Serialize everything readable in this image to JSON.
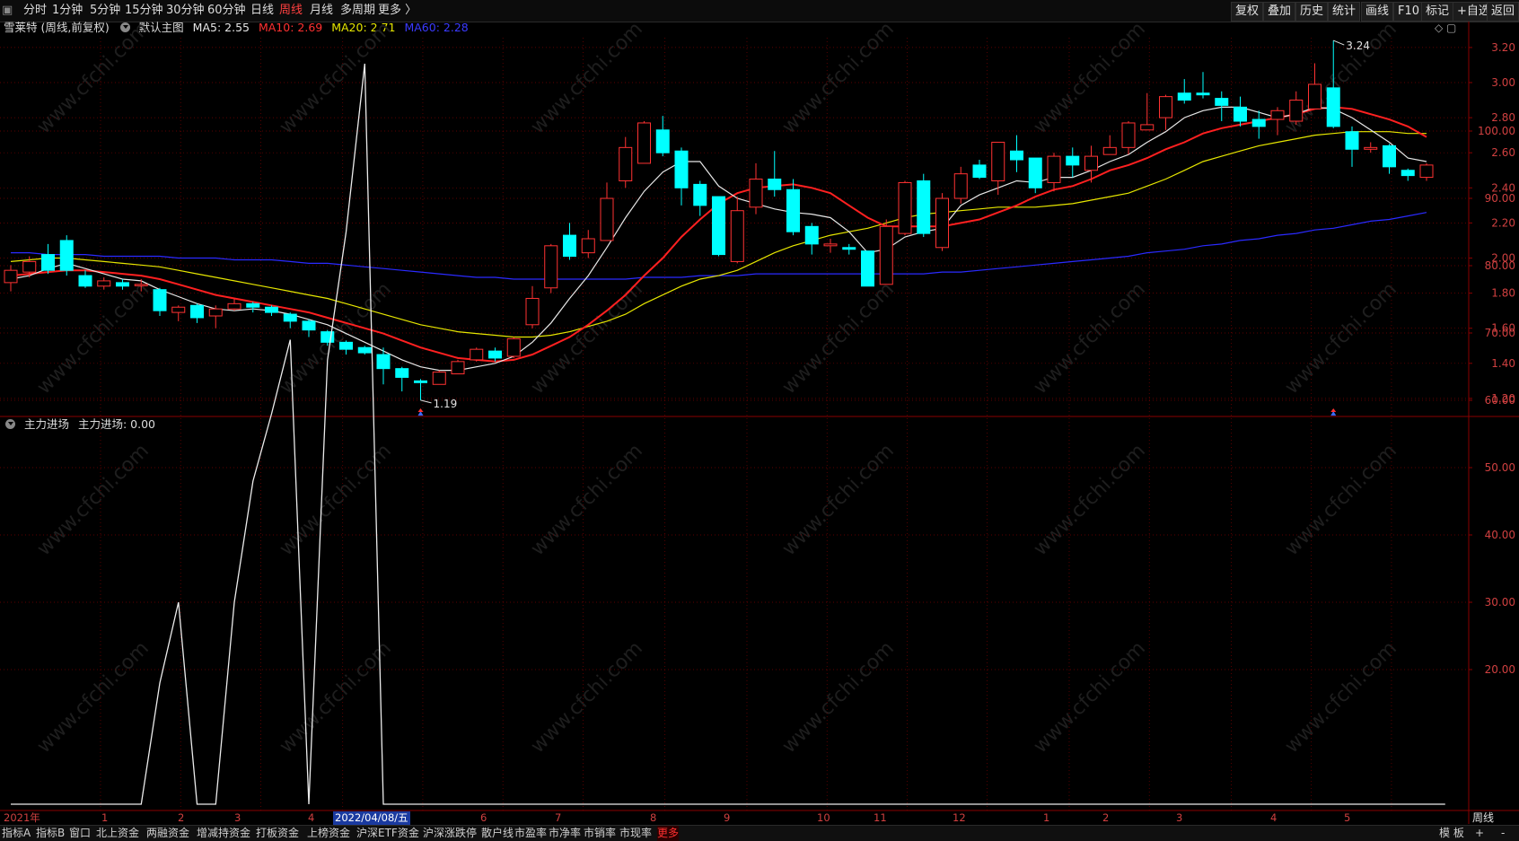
{
  "toolbar": {
    "left_items": [
      "分时",
      "1分钟",
      "5分钟",
      "15分钟",
      "30分钟",
      "60分钟",
      "日线",
      "周线",
      "月线",
      "多周期",
      "更多 〉"
    ],
    "active": "周线",
    "right_items": [
      "复权",
      "叠加",
      "历史",
      "统计",
      "画线",
      "F10",
      "标记",
      "+自选",
      "返回"
    ]
  },
  "main_legend": {
    "title": "雪莱特 (周线,前复权)",
    "template": "默认主图",
    "ma5": "MA5: 2.55",
    "ma10": "MA10: 2.69",
    "ma20": "MA20: 2.71",
    "ma60": "MA60: 2.28"
  },
  "sub_legend": {
    "title": "主力进场",
    "value": "主力进场: 0.00"
  },
  "colors": {
    "up": "#ff3232",
    "down": "#00ffff",
    "ma5": "#e6e6e6",
    "ma10": "#ff2020",
    "ma20": "#e6e600",
    "ma60": "#2a2aff",
    "grid": "#7a0000"
  },
  "price_axis": [
    "3.20",
    "3.00",
    "2.80",
    "2.60",
    "2.40",
    "2.20",
    "2.00",
    "1.80",
    "1.60",
    "1.40",
    "1.20"
  ],
  "indicator_axis": [
    "100.00",
    "90.00",
    "80.00",
    "70.00",
    "60.00",
    "50.00",
    "40.00",
    "30.00",
    "20.00"
  ],
  "annotations": {
    "high": "3.24",
    "low": "1.19"
  },
  "date_labels": [
    "2021年",
    "1",
    "2",
    "3",
    "4",
    "2022/04/08/五",
    "6",
    "7",
    "8",
    "9",
    "10",
    "11",
    "12",
    "1",
    "2",
    "3",
    "4",
    "5"
  ],
  "period_label": "周线",
  "bottom_tabs": [
    "指标A",
    "指标B",
    "窗口",
    "北上资金",
    "两融资金",
    "增减持资金",
    "打板资金",
    "上榜资金",
    "沪深ETF资金",
    "沪深涨跌停",
    "散户线",
    "市盈率",
    "市净率",
    "市销率",
    "市现率",
    "更多"
  ],
  "bottom_right": [
    "模 板",
    "+",
    "-"
  ],
  "watermark": "www.cfchi.com",
  "chart_data": {
    "type": "candlestick",
    "candles": [
      [
        1.86,
        1.93,
        1.96,
        1.81
      ],
      [
        1.92,
        1.98,
        2.01,
        1.89
      ],
      [
        2.02,
        1.93,
        2.08,
        1.91
      ],
      [
        2.1,
        1.93,
        2.13,
        1.9
      ],
      [
        1.9,
        1.84,
        1.93,
        1.83
      ],
      [
        1.84,
        1.87,
        1.89,
        1.82
      ],
      [
        1.86,
        1.84,
        1.88,
        1.82
      ],
      [
        1.85,
        1.85,
        1.88,
        1.81
      ],
      [
        1.82,
        1.7,
        1.83,
        1.67
      ],
      [
        1.69,
        1.72,
        1.73,
        1.64
      ],
      [
        1.73,
        1.66,
        1.74,
        1.63
      ],
      [
        1.67,
        1.71,
        1.73,
        1.6
      ],
      [
        1.71,
        1.74,
        1.77,
        1.7
      ],
      [
        1.74,
        1.72,
        1.75,
        1.69
      ],
      [
        1.72,
        1.69,
        1.73,
        1.67
      ],
      [
        1.68,
        1.64,
        1.69,
        1.6
      ],
      [
        1.64,
        1.59,
        1.65,
        1.55
      ],
      [
        1.58,
        1.52,
        1.59,
        1.5
      ],
      [
        1.52,
        1.48,
        1.53,
        1.45
      ],
      [
        1.49,
        1.46,
        1.5,
        1.45
      ],
      [
        1.45,
        1.37,
        1.49,
        1.28
      ],
      [
        1.37,
        1.32,
        1.38,
        1.24
      ],
      [
        1.3,
        1.29,
        1.31,
        1.19
      ],
      [
        1.28,
        1.35,
        1.36,
        1.28
      ],
      [
        1.34,
        1.41,
        1.42,
        1.34
      ],
      [
        1.42,
        1.48,
        1.49,
        1.41
      ],
      [
        1.47,
        1.43,
        1.49,
        1.41
      ],
      [
        1.44,
        1.54,
        1.55,
        1.43
      ],
      [
        1.62,
        1.77,
        1.84,
        1.6
      ],
      [
        1.83,
        2.07,
        2.08,
        1.8
      ],
      [
        2.13,
        2.01,
        2.2,
        1.99
      ],
      [
        2.03,
        2.11,
        2.16,
        2.0
      ],
      [
        2.1,
        2.34,
        2.43,
        2.1
      ],
      [
        2.44,
        2.63,
        2.69,
        2.4
      ],
      [
        2.54,
        2.77,
        2.78,
        2.54
      ],
      [
        2.73,
        2.6,
        2.81,
        2.58
      ],
      [
        2.61,
        2.4,
        2.63,
        2.3
      ],
      [
        2.42,
        2.3,
        2.44,
        2.24
      ],
      [
        2.35,
        2.02,
        2.35,
        2.01
      ],
      [
        1.98,
        2.27,
        2.35,
        1.97
      ],
      [
        2.29,
        2.45,
        2.54,
        2.25
      ],
      [
        2.45,
        2.39,
        2.61,
        2.35
      ],
      [
        2.39,
        2.15,
        2.45,
        2.13
      ],
      [
        2.18,
        2.08,
        2.2,
        2.02
      ],
      [
        2.07,
        2.08,
        2.11,
        2.03
      ],
      [
        2.06,
        2.05,
        2.08,
        2.02
      ],
      [
        2.04,
        1.84,
        2.04,
        1.84
      ],
      [
        1.85,
        2.18,
        2.22,
        1.85
      ],
      [
        2.14,
        2.43,
        2.44,
        2.13
      ],
      [
        2.44,
        2.14,
        2.48,
        2.12
      ],
      [
        2.06,
        2.34,
        2.37,
        2.04
      ],
      [
        2.34,
        2.48,
        2.52,
        2.31
      ],
      [
        2.53,
        2.46,
        2.56,
        2.45
      ],
      [
        2.44,
        2.66,
        2.66,
        2.36
      ],
      [
        2.61,
        2.56,
        2.7,
        2.49
      ],
      [
        2.57,
        2.4,
        2.57,
        2.37
      ],
      [
        2.43,
        2.58,
        2.6,
        2.38
      ],
      [
        2.58,
        2.53,
        2.63,
        2.46
      ],
      [
        2.5,
        2.58,
        2.64,
        2.43
      ],
      [
        2.59,
        2.63,
        2.7,
        2.59
      ],
      [
        2.63,
        2.77,
        2.78,
        2.59
      ],
      [
        2.73,
        2.76,
        2.94,
        2.73
      ],
      [
        2.8,
        2.92,
        2.93,
        2.73
      ],
      [
        2.94,
        2.9,
        3.02,
        2.88
      ],
      [
        2.94,
        2.93,
        3.06,
        2.91
      ],
      [
        2.91,
        2.87,
        2.95,
        2.78
      ],
      [
        2.86,
        2.78,
        2.92,
        2.75
      ],
      [
        2.79,
        2.75,
        2.84,
        2.68
      ],
      [
        2.79,
        2.84,
        2.86,
        2.7
      ],
      [
        2.78,
        2.9,
        2.95,
        2.76
      ],
      [
        2.85,
        2.99,
        3.11,
        2.85
      ],
      [
        2.97,
        2.75,
        3.24,
        2.74
      ],
      [
        2.72,
        2.62,
        2.75,
        2.52
      ],
      [
        2.62,
        2.63,
        2.66,
        2.6
      ],
      [
        2.64,
        2.52,
        2.65,
        2.48
      ],
      [
        2.5,
        2.47,
        2.51,
        2.44
      ],
      [
        2.46,
        2.53,
        2.54,
        2.44
      ]
    ],
    "ma5": [
      1.88,
      1.9,
      1.94,
      1.97,
      1.94,
      1.91,
      1.88,
      1.87,
      1.82,
      1.78,
      1.74,
      1.71,
      1.7,
      1.71,
      1.7,
      1.68,
      1.65,
      1.62,
      1.57,
      1.52,
      1.47,
      1.42,
      1.38,
      1.36,
      1.36,
      1.38,
      1.4,
      1.44,
      1.52,
      1.63,
      1.77,
      1.9,
      2.06,
      2.23,
      2.38,
      2.49,
      2.55,
      2.55,
      2.41,
      2.34,
      2.31,
      2.28,
      2.26,
      2.25,
      2.23,
      2.15,
      2.03,
      2.05,
      2.12,
      2.15,
      2.17,
      2.3,
      2.36,
      2.4,
      2.44,
      2.43,
      2.46,
      2.46,
      2.5,
      2.55,
      2.59,
      2.66,
      2.72,
      2.8,
      2.84,
      2.86,
      2.86,
      2.83,
      2.8,
      2.82,
      2.86,
      2.85,
      2.8,
      2.73,
      2.66,
      2.57,
      2.55
    ],
    "ma10": [
      1.9,
      1.91,
      1.92,
      1.93,
      1.93,
      1.92,
      1.91,
      1.9,
      1.88,
      1.85,
      1.82,
      1.79,
      1.77,
      1.75,
      1.73,
      1.71,
      1.69,
      1.66,
      1.63,
      1.6,
      1.57,
      1.53,
      1.49,
      1.46,
      1.43,
      1.42,
      1.41,
      1.42,
      1.45,
      1.5,
      1.55,
      1.62,
      1.7,
      1.79,
      1.9,
      2.0,
      2.12,
      2.22,
      2.31,
      2.37,
      2.4,
      2.41,
      2.42,
      2.4,
      2.37,
      2.3,
      2.23,
      2.18,
      2.18,
      2.18,
      2.18,
      2.2,
      2.22,
      2.26,
      2.3,
      2.35,
      2.39,
      2.41,
      2.45,
      2.5,
      2.53,
      2.57,
      2.62,
      2.66,
      2.71,
      2.74,
      2.76,
      2.78,
      2.8,
      2.82,
      2.85,
      2.86,
      2.85,
      2.82,
      2.79,
      2.75,
      2.69
    ],
    "ma20": [
      1.98,
      1.99,
      2.0,
      2.0,
      1.99,
      1.98,
      1.97,
      1.96,
      1.95,
      1.93,
      1.91,
      1.89,
      1.87,
      1.85,
      1.83,
      1.81,
      1.79,
      1.77,
      1.74,
      1.71,
      1.68,
      1.65,
      1.62,
      1.6,
      1.58,
      1.57,
      1.56,
      1.55,
      1.55,
      1.56,
      1.58,
      1.61,
      1.64,
      1.68,
      1.74,
      1.79,
      1.84,
      1.88,
      1.9,
      1.93,
      1.98,
      2.03,
      2.07,
      2.1,
      2.13,
      2.15,
      2.17,
      2.2,
      2.23,
      2.25,
      2.26,
      2.27,
      2.28,
      2.29,
      2.29,
      2.29,
      2.3,
      2.31,
      2.33,
      2.35,
      2.37,
      2.41,
      2.45,
      2.5,
      2.55,
      2.58,
      2.61,
      2.64,
      2.66,
      2.68,
      2.7,
      2.71,
      2.72,
      2.72,
      2.72,
      2.71,
      2.71
    ],
    "ma60": [
      2.03,
      2.03,
      2.02,
      2.02,
      2.02,
      2.01,
      2.01,
      2.01,
      2.01,
      2.0,
      2.0,
      2.0,
      1.99,
      1.99,
      1.99,
      1.98,
      1.97,
      1.97,
      1.96,
      1.95,
      1.94,
      1.93,
      1.92,
      1.91,
      1.9,
      1.89,
      1.89,
      1.88,
      1.88,
      1.88,
      1.88,
      1.88,
      1.88,
      1.88,
      1.89,
      1.89,
      1.89,
      1.9,
      1.9,
      1.9,
      1.91,
      1.91,
      1.91,
      1.91,
      1.91,
      1.91,
      1.91,
      1.91,
      1.91,
      1.91,
      1.92,
      1.92,
      1.93,
      1.94,
      1.95,
      1.96,
      1.97,
      1.98,
      1.99,
      2.0,
      2.01,
      2.03,
      2.04,
      2.05,
      2.07,
      2.08,
      2.1,
      2.11,
      2.13,
      2.14,
      2.16,
      2.17,
      2.19,
      2.21,
      2.22,
      2.24,
      2.26
    ],
    "indicator": {
      "name": "主力进场",
      "x_index": [
        0,
        1,
        2,
        3,
        4,
        5,
        6,
        7,
        8,
        9,
        10,
        11,
        12,
        13,
        14,
        15,
        16,
        17,
        18,
        19,
        20,
        21,
        22,
        77
      ],
      "values": [
        0,
        0,
        0,
        0,
        0,
        0,
        0,
        0,
        18,
        30,
        0,
        0,
        30,
        48,
        58,
        69,
        0,
        66,
        85,
        110,
        0,
        0,
        0,
        0
      ]
    },
    "price_ylim": [
      1.12,
      3.34
    ],
    "indicator_ylim": [
      0,
      115
    ]
  }
}
